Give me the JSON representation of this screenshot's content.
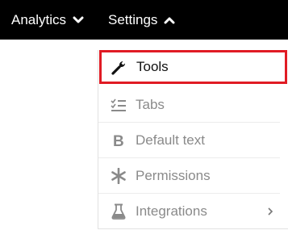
{
  "topbar": {
    "analytics_label": "Analytics",
    "settings_label": "Settings"
  },
  "settings_menu": {
    "items": [
      {
        "label": "Tools",
        "icon": "wrench-icon",
        "active": true
      },
      {
        "label": "Tabs",
        "icon": "checklist-icon",
        "active": false
      },
      {
        "label": "Default text",
        "icon": "bold-b-icon",
        "active": false
      },
      {
        "label": "Permissions",
        "icon": "asterisk-icon",
        "active": false
      },
      {
        "label": "Integrations",
        "icon": "flask-icon",
        "active": false,
        "has_submenu": true
      }
    ]
  },
  "colors": {
    "topbar_bg": "#000000",
    "highlight_border": "#e01b24",
    "muted_text": "#8a8a8a"
  }
}
